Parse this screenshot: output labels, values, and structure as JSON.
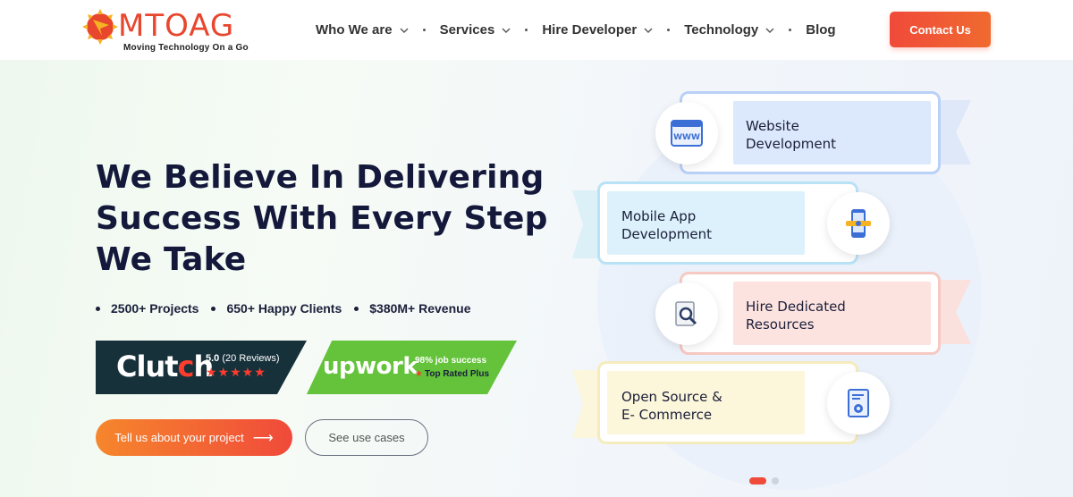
{
  "brand": {
    "name": "MTOAG",
    "tagline": "Moving Technology On a Go",
    "accent": "#e8462d"
  },
  "nav": {
    "items": [
      {
        "label": "Who We are",
        "has_dropdown": true
      },
      {
        "label": "Services",
        "has_dropdown": true
      },
      {
        "label": "Hire Developer",
        "has_dropdown": true
      },
      {
        "label": "Technology",
        "has_dropdown": true
      },
      {
        "label": "Blog",
        "has_dropdown": false
      }
    ],
    "cta": "Contact Us"
  },
  "hero": {
    "line1_light": "We Believe In ",
    "line1_bold": "Delivering",
    "line2_bold_a": "Success",
    "line2_light": " With ",
    "line2_bold_b": "Every Step",
    "line3_light": "We Take"
  },
  "stats": [
    "2500+ Projects",
    "650+ Happy Clients",
    "$380M+ Revenue"
  ],
  "badges": {
    "clutch": {
      "logo_pre": "Clut",
      "logo_o": "c",
      "logo_post": "h",
      "rating": "5.0",
      "reviews": "(20 Reviews)",
      "stars": "★★★★★"
    },
    "upwork": {
      "logo": "upwork",
      "success": "98% job success",
      "top": "Top Rated Plus"
    }
  },
  "buttons": {
    "primary": "Tell us about your project",
    "secondary": "See use cases"
  },
  "services": [
    {
      "label": "Website\nDevelopment",
      "icon": "www-browser-icon"
    },
    {
      "label": "Mobile App\nDevelopment",
      "icon": "mobile-app-icon"
    },
    {
      "label": "Hire Dedicated\nResources",
      "icon": "document-search-icon"
    },
    {
      "label": "Open Source &\nE- Commerce",
      "icon": "document-gear-icon"
    }
  ],
  "carousel": {
    "active": 1,
    "total": 2
  },
  "colors": {
    "cta_start": "#f04a3a",
    "cta_end": "#f06a2f",
    "clutch_bg": "#17313b",
    "upwork_bg": "#64c33a"
  }
}
